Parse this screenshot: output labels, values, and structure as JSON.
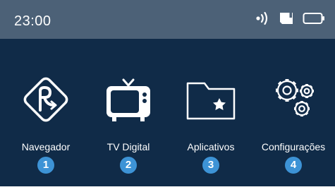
{
  "status_bar": {
    "time": "23:00",
    "icons": [
      "signal-broadcast-icon",
      "sd-card-icon",
      "battery-icon"
    ]
  },
  "apps": [
    {
      "label": "Navegador",
      "number": "1",
      "icon": "navigator-logo-icon"
    },
    {
      "label": "TV Digital",
      "number": "2",
      "icon": "tv-icon"
    },
    {
      "label": "Aplicativos",
      "number": "3",
      "icon": "folder-star-icon"
    },
    {
      "label": "Configurações",
      "number": "4",
      "icon": "gears-icon"
    }
  ],
  "colors": {
    "status_bar_bg": "#4c6177",
    "home_bg": "#102b48",
    "number_badge": "#3d93d6",
    "text": "#ffffff"
  }
}
